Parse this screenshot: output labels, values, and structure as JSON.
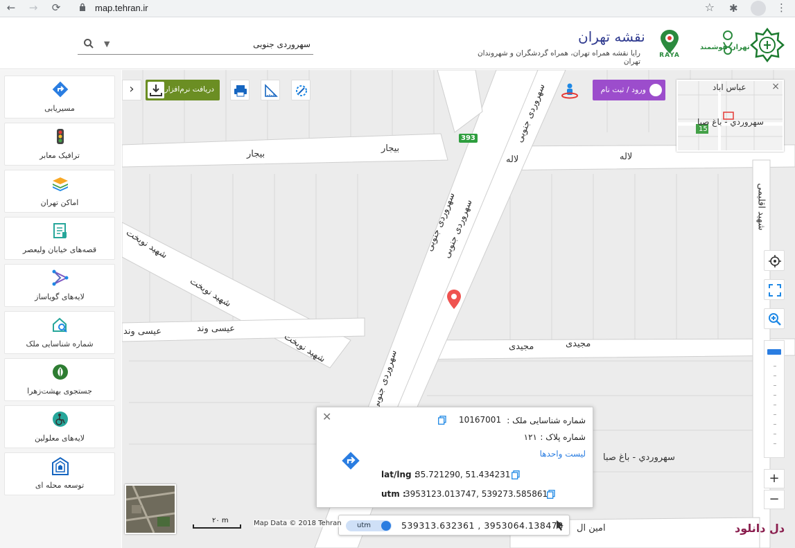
{
  "browser": {
    "url": "map.tehran.ir"
  },
  "header": {
    "search_value": "سهروردی جنوبی",
    "title": "نقشه تهران",
    "subtitle": "رایا نقشه همراه تهران، همراه گردشگران و شهروندان تهران",
    "raya_label": "RAYA",
    "smart_label": "تهران هوشمند"
  },
  "sidebar": {
    "items": [
      {
        "label": "مسیریابی",
        "icon": "route-icon"
      },
      {
        "label": "ترافیک معابر",
        "icon": "traffic-light-icon"
      },
      {
        "label": "اماکن تهران",
        "icon": "layers-icon"
      },
      {
        "label": "قصه‌های خیابان ولیعصر",
        "icon": "story-icon"
      },
      {
        "label": "لایه‌های گویاساز",
        "icon": "network-icon"
      },
      {
        "label": "شماره شناسایی ملک",
        "icon": "house-search-icon"
      },
      {
        "label": "جستجوی بهشت‌زهرا",
        "icon": "leaf-icon"
      },
      {
        "label": "لایه‌های معلولین",
        "icon": "wheelchair-icon"
      },
      {
        "label": "توسعه محله ای",
        "icon": "neighborhood-icon"
      }
    ]
  },
  "toolbar": {
    "download_label": "دریافت نرم‌افزار",
    "login_label": "ورود / ثبت نام"
  },
  "map": {
    "streets": {
      "sohrevardi_1": "سهروردی جنوبی",
      "sohrevardi_2": "سهروردی جنوبی",
      "sohrevardi_3": "سهروردی جنوبی",
      "sohrevardi_4": "سهروردی جنوبی",
      "bijar_1": "بیجار",
      "bijar_2": "بیجار",
      "laleh_1": "لاله",
      "laleh_2": "لاله",
      "nobakht_1": "شهید نوبخت",
      "nobakht_2": "شهید نوبخت",
      "nobakht_3": "شهید نوبخت",
      "isavand_1": "عیسی وند",
      "isavand_2": "عیسی وند",
      "majidi_1": "مجیدی",
      "majidi_2": "مجیدی",
      "eghlimi": "شهید اقلیمی",
      "baghsaba": "سهروردي - باغ صبا",
      "amin": "امین ال"
    },
    "road_badge": "393",
    "overview": {
      "label_abbas": "عباس اباد",
      "label_sohrevardi": "سهروردي - باغ صبا",
      "label_15": "15"
    },
    "scale_label": "۲۰ m",
    "attribution": "Map Data © 2018 Tehran",
    "watermark": "دل دانلود"
  },
  "popup": {
    "property_id_label": "شماره شناسایی ملک :",
    "property_id_value": "10167001",
    "plate_label": "شماره پلاک :",
    "plate_value": "۱۲۱",
    "units_link": "لیست واحدها",
    "latlng_label": "lat/lng :",
    "latlng_value": "35.721290, 51.434231",
    "utm_label": "utm :",
    "utm_value": "3953123.013747, 539273.585861"
  },
  "coord_bar": {
    "mode": "utm",
    "value": "539313.632361 , 3953064.138478"
  }
}
